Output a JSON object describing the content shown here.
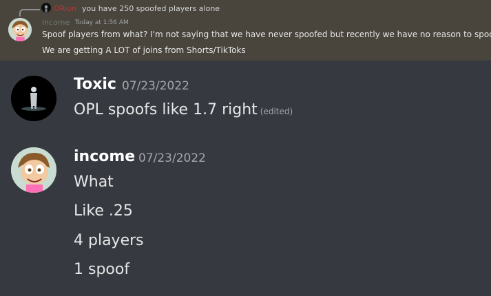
{
  "reply_context": {
    "name": "ORion",
    "text": "you have 250 spoofed players alone"
  },
  "highlighted_message": {
    "author": "income",
    "timestamp": "Today at 1:56 AM",
    "lines": [
      "Spoof players from what? I'm not saying that we have never spoofed but recently we have no reason to spoof.",
      "We are getting A LOT of joins from Shorts/TikToks"
    ]
  },
  "messages": [
    {
      "author": "Toxic",
      "timestamp": "07/23/2022",
      "lines": [
        "OPL spoofs like 1.7 right"
      ],
      "edited_label": "(edited)"
    },
    {
      "author": "income",
      "timestamp": "07/23/2022",
      "lines": [
        "What",
        "Like .25",
        "4 players",
        "1 spoof"
      ]
    }
  ],
  "colors": {
    "background": "#36393f",
    "highlight_background": "#49443c",
    "reply_name": "#b23a3a",
    "timestamp": "#a3a6aa",
    "username": "#ffffff"
  }
}
